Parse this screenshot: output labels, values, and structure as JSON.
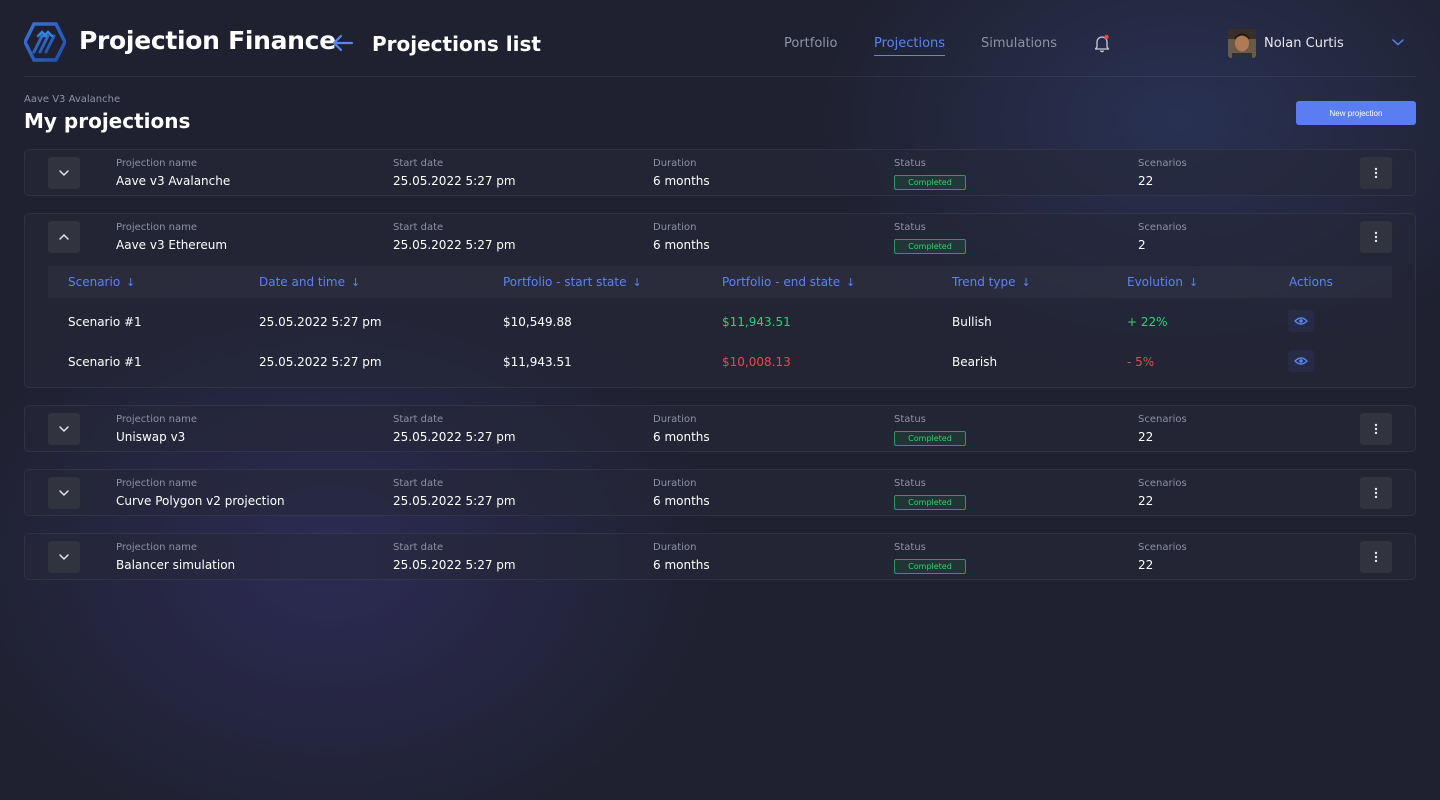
{
  "app": {
    "brand": "Projection Finance",
    "page_title": "Projections list"
  },
  "nav": {
    "portfolio": "Portfolio",
    "projections": "Projections",
    "simulations": "Simulations"
  },
  "user": {
    "name": "Nolan Curtis"
  },
  "section": {
    "subtitle": "Aave V3 Avalanche",
    "title": "My projections",
    "new_button": "New projection"
  },
  "labels": {
    "projection_name": "Projection name",
    "start_date": "Start date",
    "duration": "Duration",
    "status": "Status",
    "scenarios": "Scenarios"
  },
  "projections": [
    {
      "name": "Aave v3 Avalanche",
      "start": "25.05.2022 5:27 pm",
      "duration": "6 months",
      "status": "Completed",
      "scenarios": "22",
      "expanded": false
    },
    {
      "name": "Aave v3 Ethereum",
      "start": "25.05.2022 5:27 pm",
      "duration": "6 months",
      "status": "Completed",
      "scenarios": "2",
      "expanded": true
    },
    {
      "name": "Uniswap v3",
      "start": "25.05.2022 5:27 pm",
      "duration": "6 months",
      "status": "Completed",
      "scenarios": "22",
      "expanded": false
    },
    {
      "name": "Curve Polygon v2 projection",
      "start": "25.05.2022 5:27 pm",
      "duration": "6 months",
      "status": "Completed",
      "scenarios": "22",
      "expanded": false
    },
    {
      "name": "Balancer simulation",
      "start": "25.05.2022 5:27 pm",
      "duration": "6 months",
      "status": "Completed",
      "scenarios": "22",
      "expanded": false
    }
  ],
  "scenario_table": {
    "headers": {
      "scenario": "Scenario",
      "date_time": "Date and time",
      "start_state": "Portfolio - start state",
      "end_state": "Portfolio - end state",
      "trend": "Trend type",
      "evolution": "Evolution",
      "actions": "Actions"
    },
    "sort_arrow": "↓",
    "rows": [
      {
        "scenario": "Scenario #1",
        "date_time": "25.05.2022 5:27 pm",
        "start_state": "$10,549.88",
        "end_state": "$11,943.51",
        "trend": "Bullish",
        "evolution": "+ 22%"
      },
      {
        "scenario": "Scenario #1",
        "date_time": "25.05.2022 5:27 pm",
        "start_state": "$11,943.51",
        "end_state": "$10,008.13",
        "trend": "Bearish",
        "evolution": "- 5%"
      }
    ]
  },
  "colors": {
    "accent": "#5b84f0",
    "positive": "#35d072",
    "negative": "#e84a4a",
    "button": "#5a7df2"
  },
  "icons": {
    "logo": "projection-finance-logo",
    "back": "arrow-left-icon",
    "bell": "bell-icon",
    "chevron_down": "chevron-down-icon",
    "chevron_up": "chevron-up-icon",
    "menu": "more-vertical-icon",
    "view": "eye-icon"
  }
}
